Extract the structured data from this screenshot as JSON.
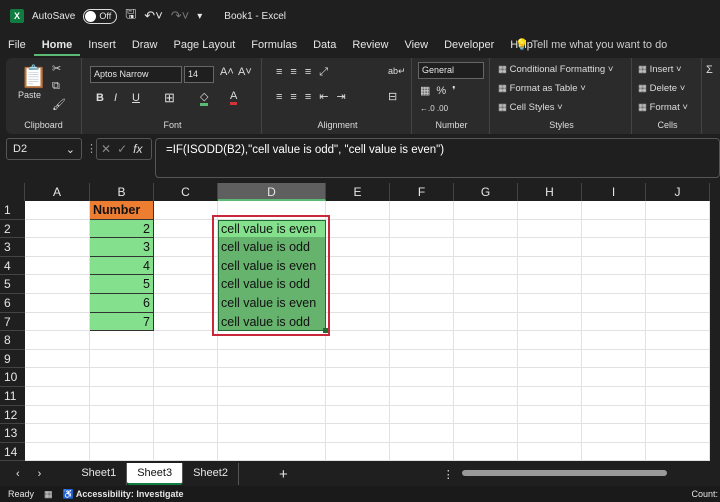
{
  "titlebar": {
    "autosave": "AutoSave",
    "toggle": "Off",
    "title": "Book1  -  Excel"
  },
  "tabs": [
    "File",
    "Home",
    "Insert",
    "Draw",
    "Page Layout",
    "Formulas",
    "Data",
    "Review",
    "View",
    "Developer",
    "Help"
  ],
  "search": "Tell me what you want to do",
  "ribbon": {
    "paste": "Paste",
    "clipboard": "Clipboard",
    "font_name": "Aptos Narrow",
    "font_size": "14",
    "font": "Font",
    "alignment": "Alignment",
    "number_format": "General",
    "number": "Number",
    "conditional": "Conditional Formatting",
    "format_table": "Format as Table",
    "cell_styles": "Cell Styles",
    "styles": "Styles",
    "insert": "Insert",
    "delete": "Delete",
    "format": "Format",
    "cells": "Cells"
  },
  "namebox": "D2",
  "formula": "=IF(ISODD(B2),\"cell value is odd\", \"cell value is even\")",
  "columns": [
    "A",
    "B",
    "C",
    "D",
    "E",
    "F",
    "G",
    "H",
    "I",
    "J"
  ],
  "selected_column": "D",
  "rows": [
    "1",
    "2",
    "3",
    "4",
    "5",
    "6",
    "7",
    "8",
    "9",
    "10",
    "11",
    "12",
    "13",
    "14"
  ],
  "cells": {
    "B1": "Number",
    "B2": "2",
    "B3": "3",
    "B4": "4",
    "B5": "5",
    "B6": "6",
    "B7": "7",
    "D2": "cell value is even",
    "D3": "cell value is odd",
    "D4": "cell value is even",
    "D5": "cell value is odd",
    "D6": "cell value is even",
    "D7": "cell value is odd"
  },
  "colors": {
    "header_fill": "#ed7d31",
    "number_fill": "#84e08c",
    "result_fill": "#66b36d",
    "selected_fill": "#84e08c",
    "highlight_border": "#c8283a"
  },
  "sheets": [
    "Sheet1",
    "Sheet3",
    "Sheet2"
  ],
  "active_sheet": "Sheet3",
  "status": {
    "ready": "Ready",
    "accessibility": "Accessibility: Investigate",
    "count": "Count:"
  }
}
